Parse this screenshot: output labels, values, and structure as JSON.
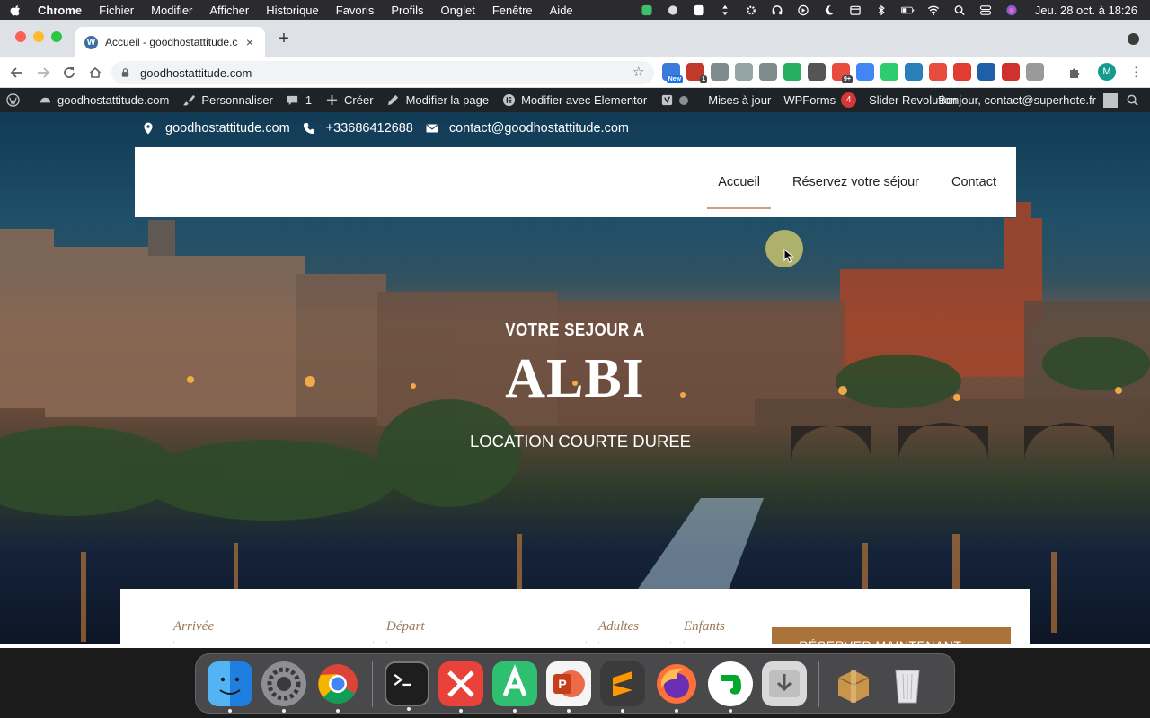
{
  "menubar": {
    "app_name": "Chrome",
    "items": [
      "Fichier",
      "Modifier",
      "Afficher",
      "Historique",
      "Favoris",
      "Profils",
      "Onglet",
      "Fenêtre",
      "Aide"
    ],
    "clock": "Jeu. 28 oct. à  18:26"
  },
  "browser": {
    "tab_title": "Accueil - goodhostattitude.com",
    "url": "goodhostattitude.com",
    "profile_initial": "M",
    "extensions": [
      {
        "name": "new-extension",
        "color": "#3c7bd8",
        "badge": "New"
      },
      {
        "name": "calendar-extension",
        "color": "#c0392b",
        "badge": "1"
      },
      {
        "name": "code-extension",
        "color": "#7f8c8d",
        "badge": ""
      },
      {
        "name": "chat-extension",
        "color": "#95a5a6",
        "badge": ""
      },
      {
        "name": "settings-extension",
        "color": "#7f8c8d",
        "badge": ""
      },
      {
        "name": "dropper-extension",
        "color": "#27ae60",
        "badge": ""
      },
      {
        "name": "wordpress-extension",
        "color": "#555555",
        "badge": ""
      },
      {
        "name": "colorful-extension",
        "color": "#e74c3c",
        "badge": "9+"
      },
      {
        "name": "translate-extension",
        "color": "#4285f4",
        "badge": ""
      },
      {
        "name": "heart-extension",
        "color": "#2ecc71",
        "badge": ""
      },
      {
        "name": "blue-extension",
        "color": "#2980b9",
        "badge": ""
      },
      {
        "name": "c-extension",
        "color": "#e74c3c",
        "badge": ""
      },
      {
        "name": "red-extension",
        "color": "#e03c31",
        "badge": ""
      },
      {
        "name": "globe-extension",
        "color": "#1f5fa8",
        "badge": ""
      },
      {
        "name": "abp-extension",
        "color": "#d0312d",
        "badge": ""
      },
      {
        "name": "grey-extension",
        "color": "#9a9a9a",
        "badge": ""
      }
    ]
  },
  "wpbar": {
    "site": "goodhostattitude.com",
    "customize": "Personnaliser",
    "comments_count": "1",
    "new": "Créer",
    "edit_page": "Modifier la page",
    "elementor": "Modifier avec Elementor",
    "updates": "Mises à jour",
    "wpforms": "WPForms",
    "wpforms_count": "4",
    "slider": "Slider Revolution",
    "greeting": "Bonjour, contact@superhote.fr"
  },
  "site": {
    "info": {
      "domain": "goodhostattitude.com",
      "phone": "+33686412688",
      "email": "contact@goodhostattitude.com"
    },
    "nav": [
      "Accueil",
      "Réservez votre séjour",
      "Contact"
    ],
    "hero": {
      "kicker": "VOTRE SEJOUR A",
      "city": "ALBI",
      "tagline": "LOCATION COURTE DUREE"
    },
    "booking": {
      "arrival": "Arrivée",
      "departure": "Départ",
      "adults": "Adultes",
      "children": "Enfants",
      "arrival_value": "-- / -- / ----",
      "departure_value": "-- / -- / ----",
      "button": "RÉSERVER MAINTENANT"
    }
  },
  "colors": {
    "accent": "#a9733a",
    "nav_underline": "#c9a27a",
    "wp_bar": "#1d2327"
  }
}
